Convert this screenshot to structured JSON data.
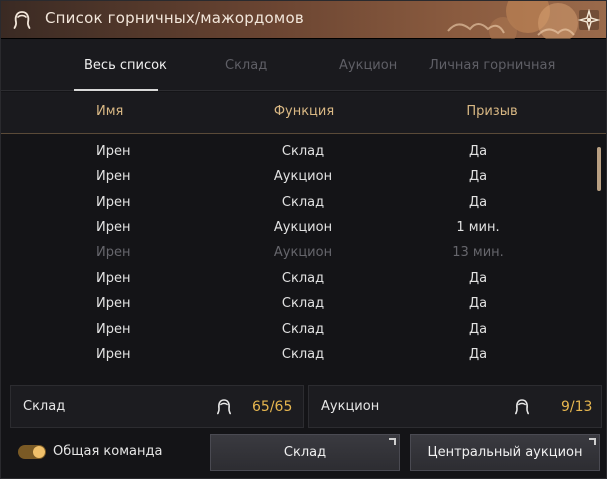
{
  "window": {
    "title": "Список горничных/мажордомов"
  },
  "tabs": [
    {
      "label": "Весь список",
      "active": true
    },
    {
      "label": "Склад",
      "active": false
    },
    {
      "label": "Аукцион",
      "active": false
    },
    {
      "label": "Личная горничная",
      "active": false
    }
  ],
  "table": {
    "headers": [
      "Имя",
      "Функция",
      "Призыв"
    ],
    "rows": [
      {
        "name": "Ирен",
        "function": "Склад",
        "summon": "Да",
        "dimmed": false
      },
      {
        "name": "Ирен",
        "function": "Аукцион",
        "summon": "Да",
        "dimmed": false
      },
      {
        "name": "Ирен",
        "function": "Склад",
        "summon": "Да",
        "dimmed": false
      },
      {
        "name": "Ирен",
        "function": "Аукцион",
        "summon": "1 мин.",
        "dimmed": false
      },
      {
        "name": "Ирен",
        "function": "Аукцион",
        "summon": "13 мин.",
        "dimmed": true
      },
      {
        "name": "Ирен",
        "function": "Склад",
        "summon": "Да",
        "dimmed": false
      },
      {
        "name": "Ирен",
        "function": "Склад",
        "summon": "Да",
        "dimmed": false
      },
      {
        "name": "Ирен",
        "function": "Склад",
        "summon": "Да",
        "dimmed": false
      },
      {
        "name": "Ирен",
        "function": "Склад",
        "summon": "Да",
        "dimmed": false
      }
    ]
  },
  "counters": {
    "storage": {
      "label": "Склад",
      "value": "65/65",
      "icon": "maid-icon"
    },
    "auction": {
      "label": "Аукцион",
      "value": "9/13",
      "icon": "maid-icon"
    }
  },
  "footer": {
    "toggle_label": "Общая команда",
    "toggle_on": true,
    "storage_button": "Склад",
    "auction_button": "Центральный аукцион"
  },
  "colors": {
    "accent": "#e6b64f",
    "header_text": "#d9b884",
    "title_bar": "#8a5b3f"
  }
}
